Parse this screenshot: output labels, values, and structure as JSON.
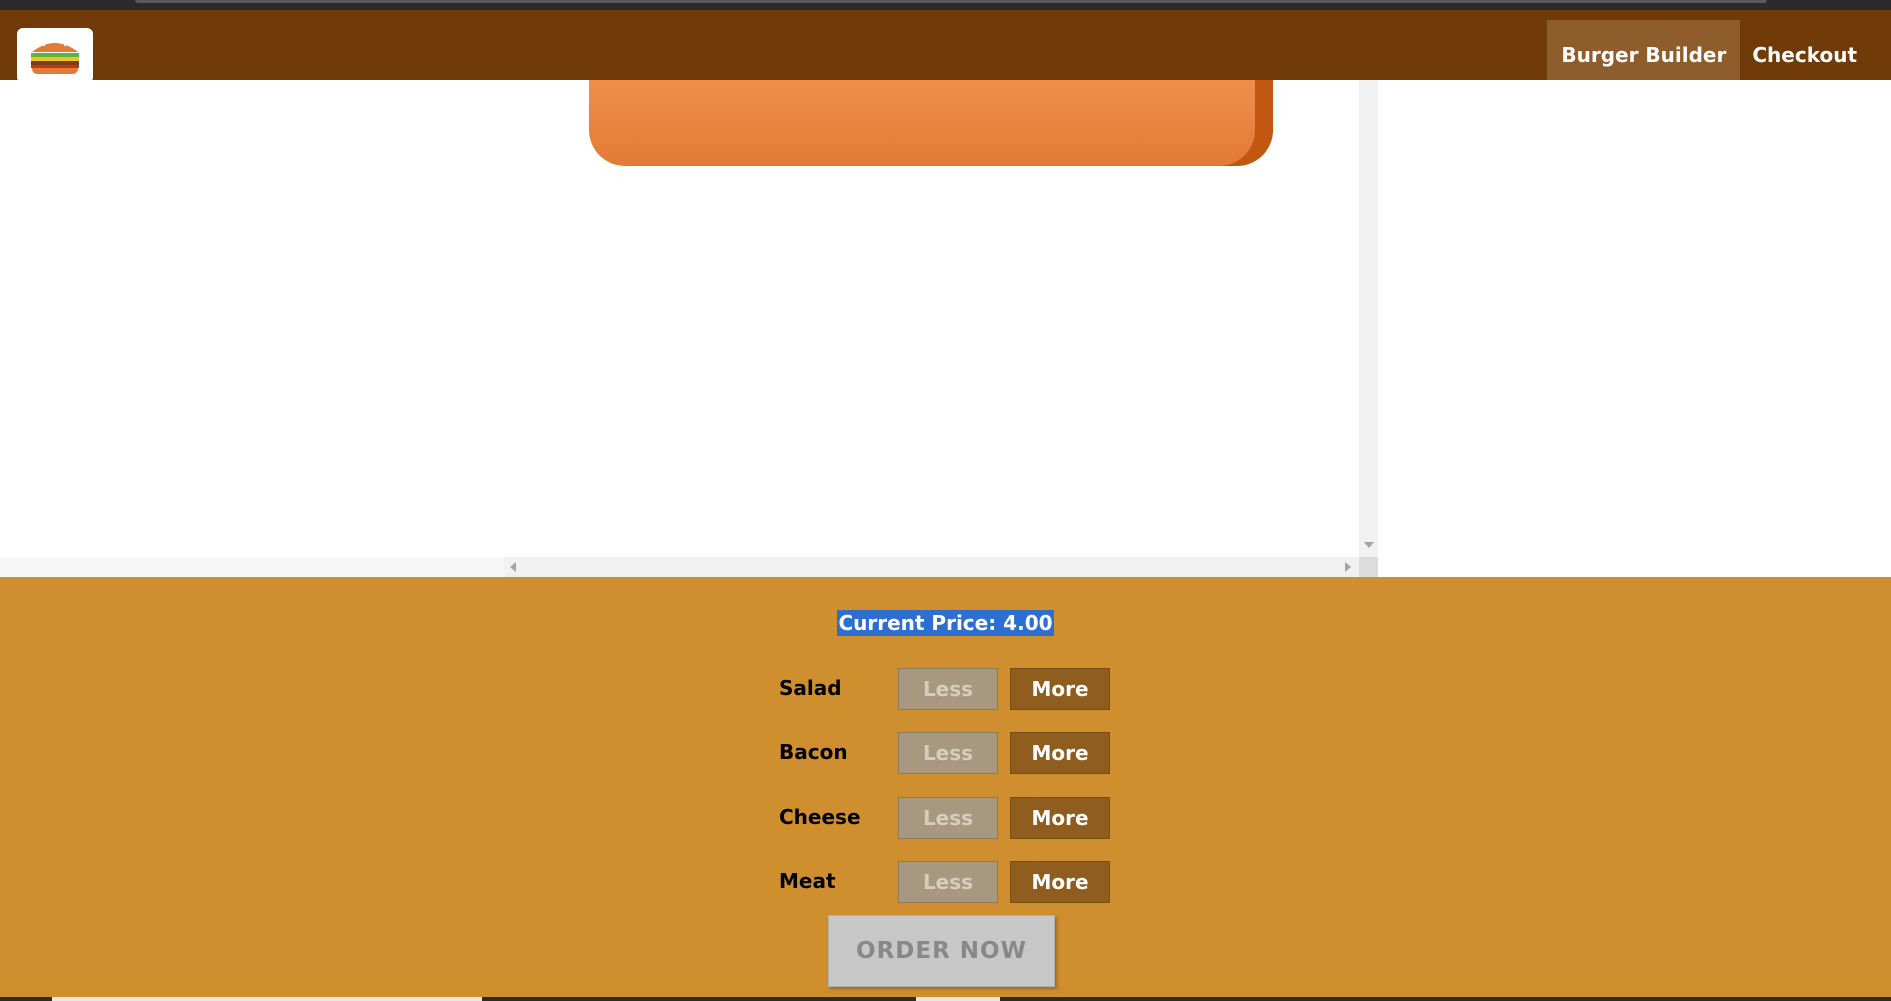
{
  "header": {
    "logo_icon": "burger-logo-icon",
    "nav": [
      {
        "label": "Burger Builder",
        "active": true
      },
      {
        "label": "Checkout",
        "active": false
      }
    ]
  },
  "colors": {
    "toolbar": "#703b09",
    "nav_active_bg": "#8f5c2c",
    "nav_active_underline": "#40a4c8",
    "controls_bg": "#cf8f2e",
    "more_button": "#8f5e1e",
    "less_button_disabled": "#a8987f",
    "bun": "#e27b36",
    "order_disabled": "#c7c7c7"
  },
  "build_controls": {
    "price_label": "Current Price: 4.00",
    "ingredients": [
      {
        "label": "Salad",
        "less": "Less",
        "more": "More"
      },
      {
        "label": "Bacon",
        "less": "Less",
        "more": "More"
      },
      {
        "label": "Cheese",
        "less": "Less",
        "more": "More"
      },
      {
        "label": "Meat",
        "less": "Less",
        "more": "More"
      }
    ],
    "order_button": "ORDER NOW"
  }
}
